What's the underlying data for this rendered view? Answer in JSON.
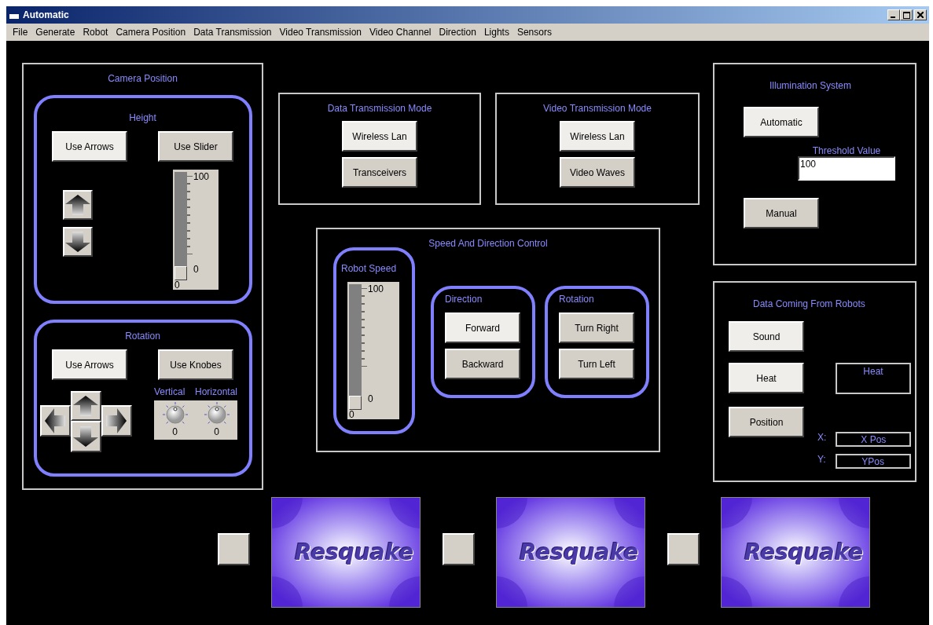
{
  "window": {
    "title": "Automatic"
  },
  "menu": [
    "File",
    "Generate",
    "Robot",
    "Camera Position",
    "Data Transmission",
    "Video Transmission",
    "Video Channel",
    "Direction",
    "Lights",
    "Sensors"
  ],
  "camera_position": {
    "title": "Camera Position",
    "height": {
      "title": "Height",
      "buttons": [
        {
          "label": "Use Arrows",
          "selected": true
        },
        {
          "label": "Use Slider",
          "selected": false
        }
      ],
      "slider": {
        "max_label": "100",
        "min_label": "0",
        "value": "0",
        "level": 0
      }
    },
    "rotation": {
      "title": "Rotation",
      "buttons": [
        {
          "label": "Use Arrows",
          "selected": true
        },
        {
          "label": "Use Knobes",
          "selected": false
        }
      ],
      "knobs": [
        {
          "label": "Vertical",
          "value": "0"
        },
        {
          "label": "Horizontal",
          "value": "0"
        }
      ]
    }
  },
  "data_transmission": {
    "title": "Data Transmission Mode",
    "buttons": [
      {
        "label": "Wireless Lan",
        "selected": true
      },
      {
        "label": "Transceivers",
        "selected": false
      }
    ]
  },
  "video_transmission": {
    "title": "Video Transmission Mode",
    "buttons": [
      {
        "label": "Wireless Lan",
        "selected": true
      },
      {
        "label": "Video Waves",
        "selected": false
      }
    ]
  },
  "speed_direction": {
    "title": "Speed And Direction Control",
    "robot_speed": {
      "title": "Robot Speed",
      "slider": {
        "max_label": "100",
        "min_label": "0",
        "value": "0",
        "level": 0
      }
    },
    "direction": {
      "title": "Direction",
      "buttons": [
        {
          "label": "Forward",
          "selected": true
        },
        {
          "label": "Backward",
          "selected": false
        }
      ]
    },
    "rotation": {
      "title": "Rotation",
      "buttons": [
        {
          "label": "Turn Right",
          "selected": false
        },
        {
          "label": "Turn Left",
          "selected": false
        }
      ]
    }
  },
  "illumination": {
    "title": "Illumination System",
    "buttons": [
      {
        "label": "Automatic",
        "selected": true
      },
      {
        "label": "Manual",
        "selected": false
      }
    ],
    "threshold": {
      "label": "Threshold Value",
      "value": "100"
    }
  },
  "robot_data": {
    "title": "Data Coming From Robots",
    "buttons": [
      {
        "label": "Sound",
        "selected": true
      },
      {
        "label": "Heat",
        "selected": true
      },
      {
        "label": "Position",
        "selected": false
      }
    ],
    "heat_display": "Heat",
    "x": {
      "label": "X:",
      "value": "X Pos"
    },
    "y": {
      "label": "Y:",
      "value": "YPos"
    }
  },
  "video_channels": [
    {
      "caption": "Resquake"
    },
    {
      "caption": "Resquake"
    },
    {
      "caption": "Resquake"
    }
  ]
}
